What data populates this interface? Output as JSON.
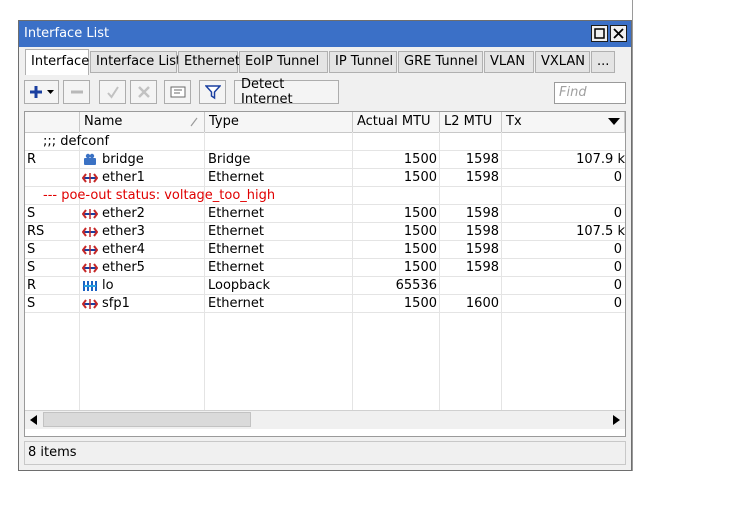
{
  "window": {
    "title": "Interface List"
  },
  "tabs": [
    "Interface",
    "Interface List",
    "Ethernet",
    "EoIP Tunnel",
    "IP Tunnel",
    "GRE Tunnel",
    "VLAN",
    "VXLAN",
    "..."
  ],
  "toolbar": {
    "detect_internet_label": "Detect Internet",
    "find_placeholder": "Find"
  },
  "columns": [
    "Name",
    "Type",
    "Actual MTU",
    "L2 MTU",
    "Tx"
  ],
  "rows": [
    {
      "kind": "comment",
      "text": ";;; defconf"
    },
    {
      "flag": "R",
      "name": "bridge",
      "icon": "bridge-icon",
      "type": "Bridge",
      "mtu": "1500",
      "l2mtu": "1598",
      "tx": "107.9 k"
    },
    {
      "flag": "",
      "name": "ether1",
      "icon": "ethernet-icon",
      "type": "Ethernet",
      "mtu": "1500",
      "l2mtu": "1598",
      "tx": "0"
    },
    {
      "kind": "comment-red",
      "text": "--- poe-out status: voltage_too_high"
    },
    {
      "flag": "S",
      "name": "ether2",
      "icon": "ethernet-icon",
      "type": "Ethernet",
      "mtu": "1500",
      "l2mtu": "1598",
      "tx": "0"
    },
    {
      "flag": "RS",
      "name": "ether3",
      "icon": "ethernet-icon",
      "type": "Ethernet",
      "mtu": "1500",
      "l2mtu": "1598",
      "tx": "107.5 k"
    },
    {
      "flag": "S",
      "name": "ether4",
      "icon": "ethernet-icon",
      "type": "Ethernet",
      "mtu": "1500",
      "l2mtu": "1598",
      "tx": "0"
    },
    {
      "flag": "S",
      "name": "ether5",
      "icon": "ethernet-icon",
      "type": "Ethernet",
      "mtu": "1500",
      "l2mtu": "1598",
      "tx": "0"
    },
    {
      "flag": "R",
      "name": "lo",
      "icon": "loopback-icon",
      "type": "Loopback",
      "mtu": "65536",
      "l2mtu": "",
      "tx": "0"
    },
    {
      "flag": "S",
      "name": "sfp1",
      "icon": "ethernet-icon",
      "type": "Ethernet",
      "mtu": "1500",
      "l2mtu": "1600",
      "tx": "0"
    }
  ],
  "status": {
    "items_text": "8 items"
  },
  "colors": {
    "titlebar": "#3b70c7",
    "accent_blue": "#1a3fa0",
    "comment_red": "#e00000"
  }
}
